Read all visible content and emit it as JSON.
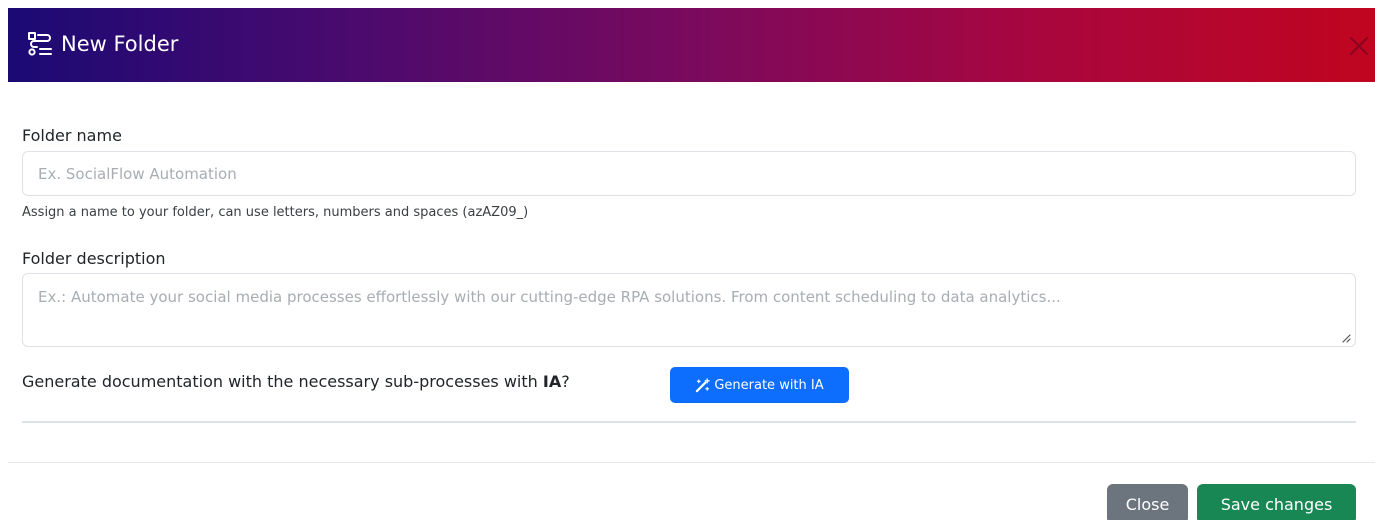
{
  "modal": {
    "title": "New Folder",
    "header_icon": "route-icon",
    "close_icon": "close-icon",
    "colors": {
      "header_gradient_start": "#1b0a74",
      "header_gradient_end": "#c0051f",
      "primary": "#0d6efd",
      "secondary": "#6c757d",
      "success": "#198754"
    }
  },
  "form": {
    "folder_name": {
      "label": "Folder name",
      "value": "",
      "placeholder": "Ex. SocialFlow Automation",
      "help": "Assign a name to your folder, can use letters, numbers and spaces (azAZ09_)"
    },
    "folder_description": {
      "label": "Folder description",
      "value": "",
      "placeholder": "Ex.: Automate your social media processes effortlessly with our cutting-edge RPA solutions. From content scheduling to data analytics..."
    },
    "generate": {
      "prompt_text": "Generate documentation with the necessary sub-processes with ",
      "prompt_emphasis": "IA",
      "prompt_suffix": "?",
      "button_label": "Generate with IA",
      "button_icon": "magic-wand-icon"
    }
  },
  "footer": {
    "close_label": "Close",
    "save_label": "Save changes"
  }
}
